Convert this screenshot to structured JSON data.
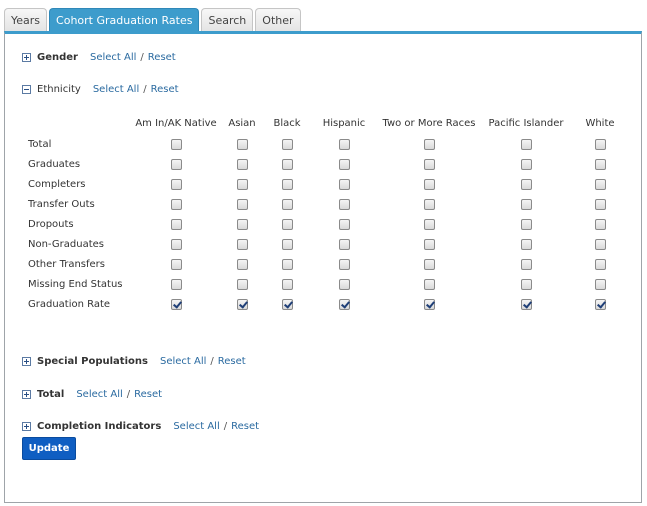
{
  "tabs": [
    {
      "label": "Years",
      "active": false
    },
    {
      "label": "Cohort Graduation Rates",
      "active": true
    },
    {
      "label": "Search",
      "active": false
    },
    {
      "label": "Other",
      "active": false
    }
  ],
  "sections": {
    "gender": {
      "title": "Gender",
      "expanded": false,
      "select_all": "Select All",
      "sep": "/",
      "reset": "Reset"
    },
    "ethnicity": {
      "title": "Ethnicity",
      "expanded": true,
      "select_all": "Select All",
      "sep": "/",
      "reset": "Reset"
    },
    "special_populations": {
      "title": "Special Populations",
      "expanded": false,
      "select_all": "Select All",
      "sep": "/",
      "reset": "Reset"
    },
    "total": {
      "title": "Total",
      "expanded": false,
      "select_all": "Select All",
      "sep": "/",
      "reset": "Reset"
    },
    "completion_indicators": {
      "title": "Completion Indicators",
      "expanded": false,
      "select_all": "Select All",
      "sep": "/",
      "reset": "Reset"
    }
  },
  "ethnicity_grid": {
    "columns": [
      "Am In/AK Native",
      "Asian",
      "Black",
      "Hispanic",
      "Two or More Races",
      "Pacific Islander",
      "White"
    ],
    "rows": [
      {
        "label": "Total",
        "checked": [
          false,
          false,
          false,
          false,
          false,
          false,
          false
        ]
      },
      {
        "label": "Graduates",
        "checked": [
          false,
          false,
          false,
          false,
          false,
          false,
          false
        ]
      },
      {
        "label": "Completers",
        "checked": [
          false,
          false,
          false,
          false,
          false,
          false,
          false
        ]
      },
      {
        "label": "Transfer Outs",
        "checked": [
          false,
          false,
          false,
          false,
          false,
          false,
          false
        ]
      },
      {
        "label": "Dropouts",
        "checked": [
          false,
          false,
          false,
          false,
          false,
          false,
          false
        ]
      },
      {
        "label": "Non-Graduates",
        "checked": [
          false,
          false,
          false,
          false,
          false,
          false,
          false
        ]
      },
      {
        "label": "Other Transfers",
        "checked": [
          false,
          false,
          false,
          false,
          false,
          false,
          false
        ]
      },
      {
        "label": "Missing End Status",
        "checked": [
          false,
          false,
          false,
          false,
          false,
          false,
          false
        ]
      },
      {
        "label": "Graduation Rate",
        "checked": [
          true,
          true,
          true,
          true,
          true,
          true,
          true
        ]
      }
    ]
  },
  "update_button": "Update",
  "colors": {
    "accent": "#3d9ccc",
    "button": "#0f5ec2",
    "link": "#2a6aa0"
  }
}
